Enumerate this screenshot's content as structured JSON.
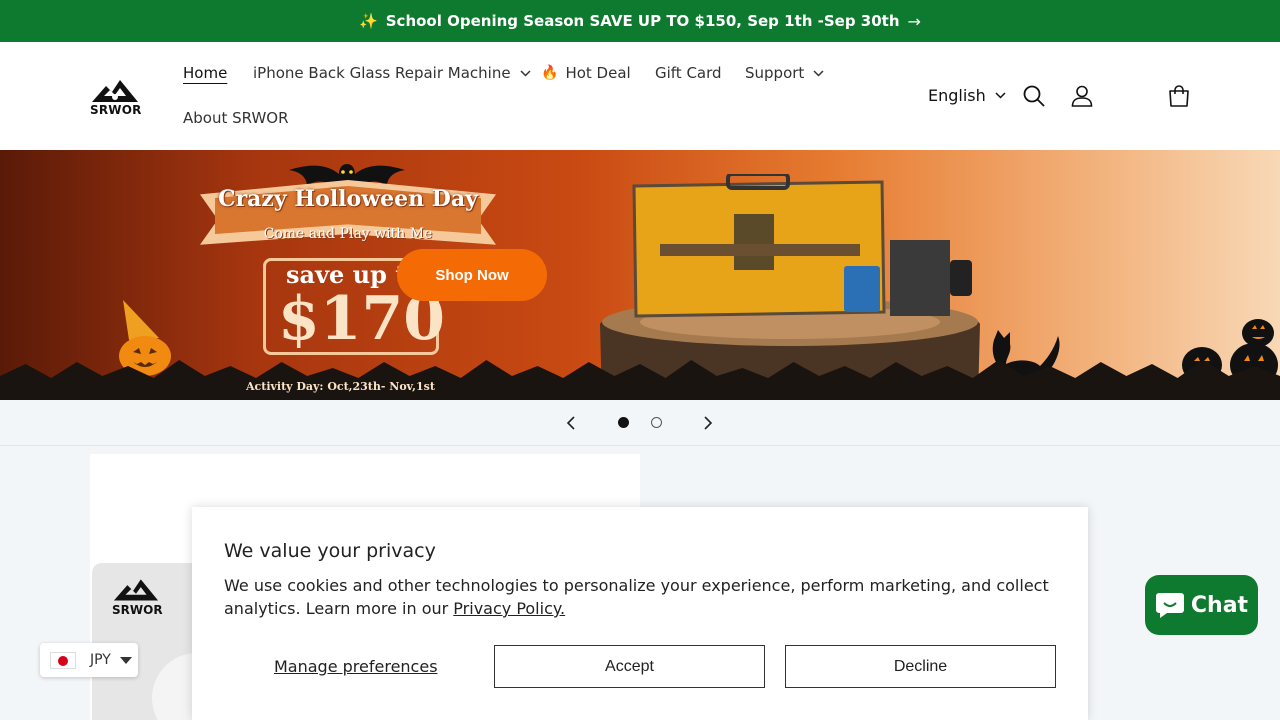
{
  "announcement": {
    "sparkle": "✨",
    "text": "School Opening Season SAVE UP TO $150, Sep 1th -Sep 30th",
    "arrow": "→"
  },
  "logo": {
    "text": "SRWOR"
  },
  "nav": {
    "home": "Home",
    "repair_machine": "iPhone Back Glass Repair Machine",
    "hot_deal": "Hot Deal",
    "gift_card": "Gift Card",
    "support": "Support",
    "about": "About SRWOR"
  },
  "header": {
    "language": "English"
  },
  "banner": {
    "title": "Crazy Holloween Day",
    "subtitle": "Come and Play with Me",
    "save_prefix": "save up t",
    "amount": "$170",
    "activity": "Activity Day: Oct,23th- Nov,1st",
    "cta": "Shop Now"
  },
  "slider": {
    "prev": "‹",
    "next": "›",
    "total": 2,
    "active": 1
  },
  "product_card": {
    "logo_text": "SRWOR"
  },
  "cookie": {
    "title": "We value your privacy",
    "body": "We use cookies and other technologies to personalize your experience, perform marketing, and collect analytics. Learn more in our ",
    "link": "Privacy Policy.",
    "manage": "Manage preferences",
    "accept": "Accept",
    "decline": "Decline"
  },
  "currency": {
    "code": "JPY"
  },
  "chat": {
    "label": "Chat"
  },
  "colors": {
    "brand_green": "#0e7a2f",
    "cta_orange": "#f46a05"
  }
}
